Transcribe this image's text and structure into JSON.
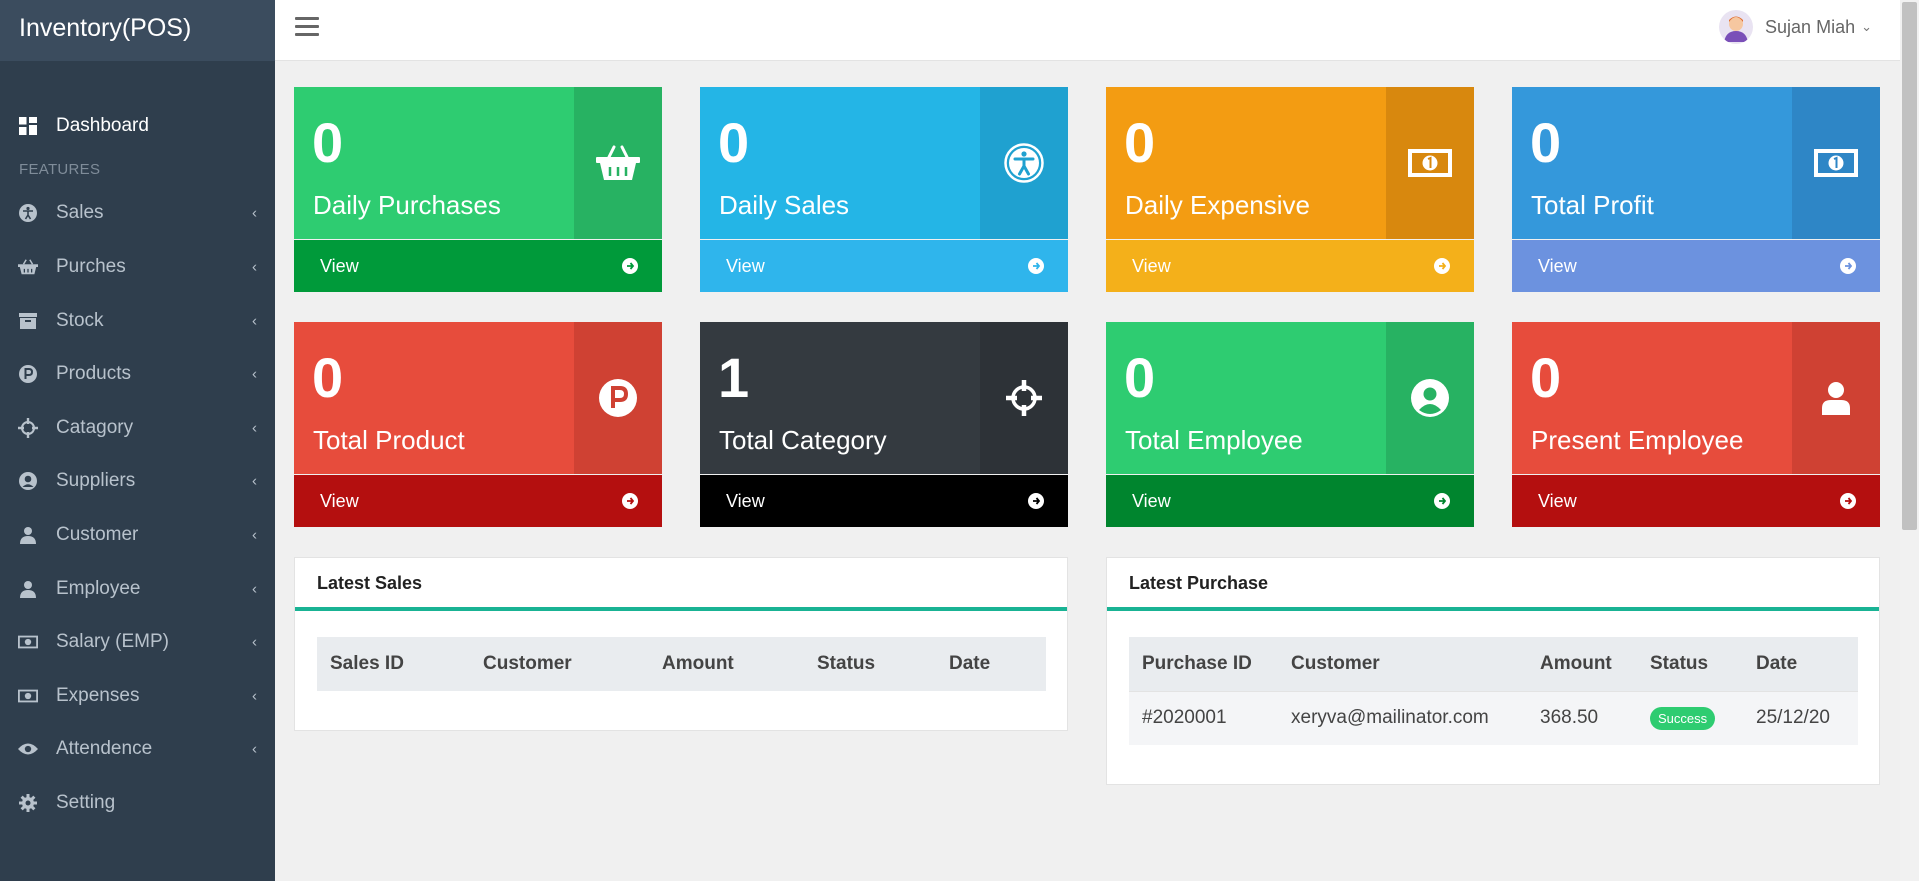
{
  "app": {
    "brand": "Inventory(POS)"
  },
  "topbar": {
    "user_name": "Sujan Miah"
  },
  "sidebar": {
    "dashboard": {
      "label": "Dashboard",
      "icon": "dashboard-icon"
    },
    "features_header": "FEATURES",
    "items": [
      {
        "label": "Sales",
        "icon": "accessibility-icon"
      },
      {
        "label": "Purches",
        "icon": "basket-icon"
      },
      {
        "label": "Stock",
        "icon": "archive-icon"
      },
      {
        "label": "Products",
        "icon": "product-p-icon"
      },
      {
        "label": "Catagory",
        "icon": "crosshair-icon"
      },
      {
        "label": "Suppliers",
        "icon": "user-circle-icon"
      },
      {
        "label": "Customer",
        "icon": "user-icon"
      },
      {
        "label": "Employee",
        "icon": "user-icon"
      },
      {
        "label": "Salary (EMP)",
        "icon": "money-icon"
      },
      {
        "label": "Expenses",
        "icon": "money-icon"
      },
      {
        "label": "Attendence",
        "icon": "eye-icon"
      },
      {
        "label": "Setting",
        "icon": "gear-icon"
      }
    ]
  },
  "cards": [
    {
      "value": "0",
      "label": "Daily Purchases",
      "footer": "View",
      "icon": "basket-icon",
      "colors": {
        "top": "#2ecc71",
        "icon": "#27b262",
        "foot": "#009a3a"
      }
    },
    {
      "value": "0",
      "label": "Daily Sales",
      "footer": "View",
      "icon": "accessibility-icon",
      "colors": {
        "top": "#24b5e6",
        "icon": "#1fa1d0",
        "foot": "#2fb5ec"
      }
    },
    {
      "value": "0",
      "label": "Daily Expensive",
      "footer": "View",
      "icon": "money-icon",
      "colors": {
        "top": "#f39c12",
        "icon": "#d8880e",
        "foot": "#f4b01a"
      }
    },
    {
      "value": "0",
      "label": "Total Profit",
      "footer": "View",
      "icon": "money-icon",
      "colors": {
        "top": "#3498db",
        "icon": "#2e86c6",
        "foot": "#6c92df"
      }
    },
    {
      "value": "0",
      "label": "Total Product",
      "footer": "View",
      "icon": "product-p-icon",
      "colors": {
        "top": "#e74c3c",
        "icon": "#cf4133",
        "foot": "#b40f0f"
      }
    },
    {
      "value": "1",
      "label": "Total Category",
      "footer": "View",
      "icon": "crosshair-icon",
      "colors": {
        "top": "#343a40",
        "icon": "#2d3237",
        "foot": "#000000"
      }
    },
    {
      "value": "0",
      "label": "Total Employee",
      "footer": "View",
      "icon": "user-circle-icon",
      "colors": {
        "top": "#2ecc71",
        "icon": "#27b262",
        "foot": "#00852e"
      }
    },
    {
      "value": "0",
      "label": "Present Employee",
      "footer": "View",
      "icon": "user-icon",
      "colors": {
        "top": "#e74c3c",
        "icon": "#cf4133",
        "foot": "#b40f0f"
      }
    }
  ],
  "latest_sales": {
    "title": "Latest Sales",
    "columns": [
      "Sales ID",
      "Customer",
      "Amount",
      "Status",
      "Date"
    ],
    "rows": []
  },
  "latest_purchase": {
    "title": "Latest Purchase",
    "columns": [
      "Purchase ID",
      "Customer",
      "Amount",
      "Status",
      "Date"
    ],
    "rows": [
      {
        "id": "#2020001",
        "customer": "xeryva@mailinator.com",
        "amount": "368.50",
        "status": "Success",
        "date": "25/12/20"
      }
    ]
  }
}
